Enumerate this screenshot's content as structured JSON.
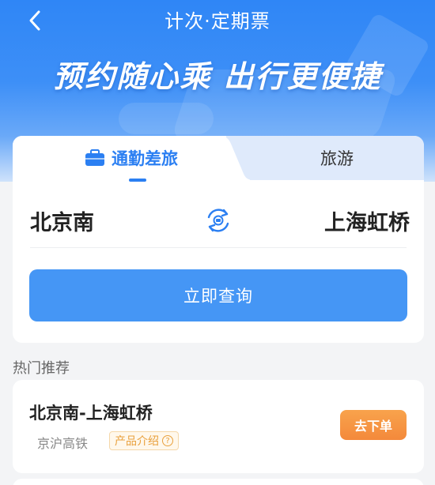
{
  "header": {
    "title": "计次·定期票",
    "slogan": "预约随心乘 出行更便捷"
  },
  "tabs": [
    {
      "label": "通勤差旅",
      "active": true,
      "icon": "briefcase-icon"
    },
    {
      "label": "旅游",
      "active": false
    }
  ],
  "search": {
    "from_station": "北京南",
    "to_station": "上海虹桥",
    "swap_icon": "swap-stations-icon",
    "query_button": "立即查询"
  },
  "recommend": {
    "section_title": "热门推荐",
    "items": [
      {
        "route": "北京南-上海虹桥",
        "line": "京沪高铁",
        "intro_label": "产品介绍",
        "order_button": "去下单"
      }
    ]
  },
  "colors": {
    "primary": "#2b7ff2",
    "button": "#4596f5",
    "orange": "#f4893b",
    "intro_text": "#e9a03c"
  }
}
